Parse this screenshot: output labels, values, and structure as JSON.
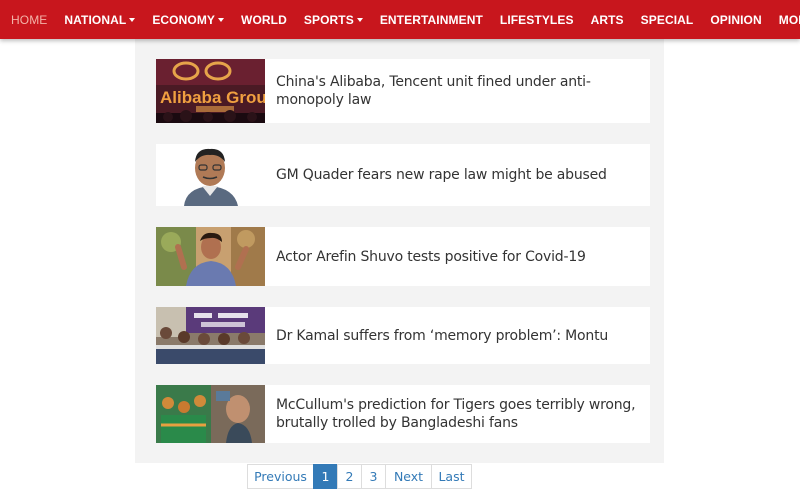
{
  "nav": {
    "items": [
      {
        "label": "HOME",
        "active": true,
        "dropdown": false
      },
      {
        "label": "NATIONAL",
        "active": false,
        "dropdown": true
      },
      {
        "label": "ECONOMY",
        "active": false,
        "dropdown": true
      },
      {
        "label": "WORLD",
        "active": false,
        "dropdown": false
      },
      {
        "label": "SPORTS",
        "active": false,
        "dropdown": true
      },
      {
        "label": "ENTERTAINMENT",
        "active": false,
        "dropdown": false
      },
      {
        "label": "LIFESTYLES",
        "active": false,
        "dropdown": false
      },
      {
        "label": "ARTS",
        "active": false,
        "dropdown": false
      },
      {
        "label": "SPECIAL",
        "active": false,
        "dropdown": false
      },
      {
        "label": "OPINION",
        "active": false,
        "dropdown": false
      },
      {
        "label": "MORE",
        "active": false,
        "dropdown": false
      }
    ]
  },
  "articles": [
    {
      "headline": "China's Alibaba, Tencent unit fined under anti-monopoly law",
      "logo_text": "Alibaba Group"
    },
    {
      "headline": "GM Quader fears new rape law might be abused"
    },
    {
      "headline": "Actor Arefin Shuvo tests positive for Covid-19"
    },
    {
      "headline": "Dr Kamal suffers from ‘memory problem’: Montu"
    },
    {
      "headline": "McCullum's prediction for Tigers goes terribly wrong, brutally trolled by Bangladeshi fans"
    }
  ],
  "pagination": {
    "previous": "Previous",
    "pages": [
      "1",
      "2",
      "3"
    ],
    "active_page": "1",
    "next": "Next",
    "last": "Last"
  },
  "colors": {
    "navbar": "#c8161d",
    "link": "#337ab7",
    "panel": "#f3f3f3"
  }
}
